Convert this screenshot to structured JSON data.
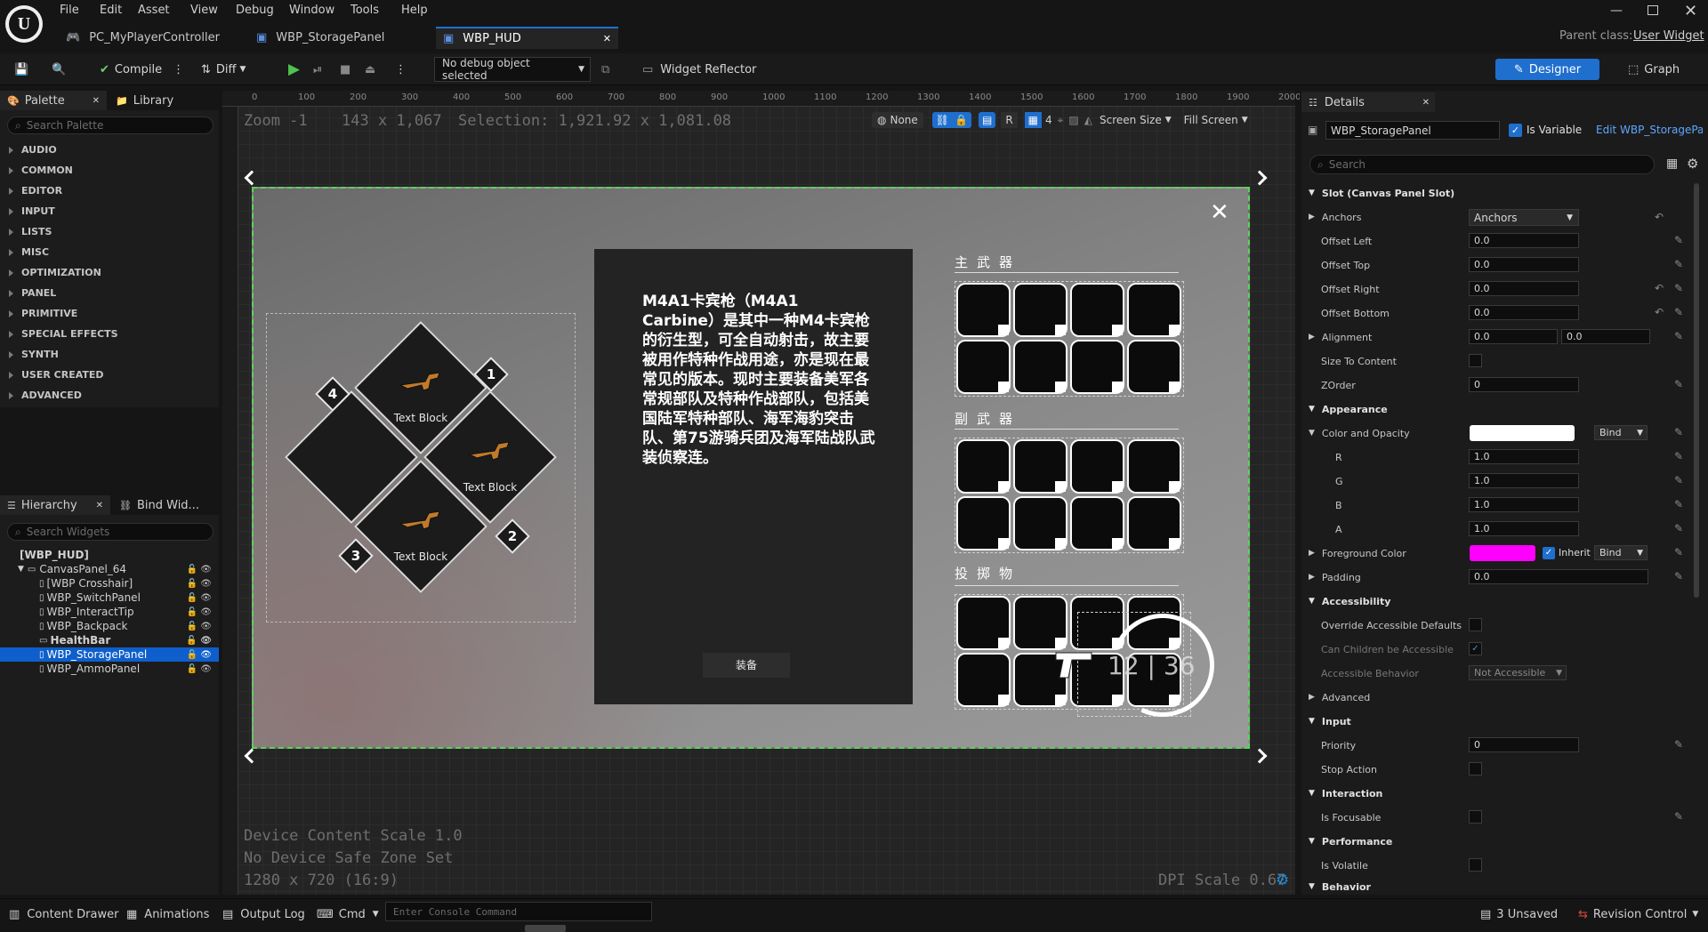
{
  "menu": [
    "File",
    "Edit",
    "Asset",
    "View",
    "Debug",
    "Window",
    "Tools",
    "Help"
  ],
  "tabs": [
    "PC_MyPlayerController",
    "WBP_StoragePanel",
    "WBP_HUD"
  ],
  "parent_class": {
    "label": "Parent class:",
    "value": "User Widget"
  },
  "toolbar": {
    "compile": "Compile",
    "diff": "Diff",
    "debug_select": "No debug object selected",
    "widget_reflector": "Widget Reflector",
    "designer": "Designer",
    "graph": "Graph"
  },
  "palette": {
    "tab": "Palette",
    "library": "Library",
    "search_placeholder": "Search Palette",
    "categories": [
      "AUDIO",
      "COMMON",
      "EDITOR",
      "INPUT",
      "LISTS",
      "MISC",
      "OPTIMIZATION",
      "PANEL",
      "PRIMITIVE",
      "SPECIAL EFFECTS",
      "SYNTH",
      "USER CREATED",
      "ADVANCED"
    ]
  },
  "hierarchy": {
    "tab": "Hierarchy",
    "bind": "Bind Wid...",
    "search_placeholder": "Search Widgets",
    "items": [
      "[WBP_HUD]",
      "CanvasPanel_64",
      "[WBP Crosshair]",
      "WBP_SwitchPanel",
      "WBP_InteractTip",
      "WBP_Backpack",
      "HealthBar",
      "WBP_StoragePanel",
      "WBP_AmmoPanel"
    ]
  },
  "canvas": {
    "zoom": "Zoom -1",
    "size": "143 x 1,067",
    "selection": "Selection: 1,921.92 x 1,081.08",
    "none": "None",
    "r": "R",
    "grid": "4",
    "screen_size": "Screen Size",
    "fill_screen": "Fill Screen",
    "ruler": [
      "0",
      "100",
      "200",
      "300",
      "400",
      "500",
      "600",
      "700",
      "800",
      "900",
      "1000",
      "1100",
      "1200",
      "1300",
      "1400",
      "1500",
      "1600",
      "1700",
      "1800",
      "1900",
      "2000"
    ],
    "device_scale": "Device Content Scale 1.0",
    "safe_zone": "No Device Safe Zone Set",
    "resolution": "1280 x 720 (16:9)",
    "dpi": "DPI Scale 0.67"
  },
  "hud": {
    "wheel_labels": [
      "Text Block",
      "Text Block",
      "Text Block"
    ],
    "wheel_nums": [
      "1",
      "2",
      "3",
      "4"
    ],
    "description_1": "M4A1卡宾枪（M4A1 Carbine）是其中一种M4卡宾枪的衍生型，可全自动射击，故主要被用作特种作战用途，亦是现在最常见的版本。现时主要装备美军各常规部队及特种作战部队，包括美国陆军特种部队、海军海豹突击队、第75游骑兵团及海军陆战队武装侦察连。",
    "equip": "装备",
    "sections": [
      "主武器",
      "副武器",
      "投掷物"
    ],
    "ammo": "12 | 36"
  },
  "details": {
    "tab": "Details",
    "name": "WBP_StoragePanel",
    "is_variable": "Is Variable",
    "edit_link": "Edit WBP_StoragePanel",
    "search_placeholder": "Search",
    "slot_section": "Slot (Canvas Panel Slot)",
    "anchors_label": "Anchors",
    "anchors_value": "Anchors",
    "offset_left": {
      "label": "Offset Left",
      "value": "0.0"
    },
    "offset_top": {
      "label": "Offset Top",
      "value": "0.0"
    },
    "offset_right": {
      "label": "Offset Right",
      "value": "0.0"
    },
    "offset_bottom": {
      "label": "Offset Bottom",
      "value": "0.0"
    },
    "alignment": {
      "label": "Alignment",
      "x": "0.0",
      "y": "0.0"
    },
    "size_to_content": "Size To Content",
    "zorder": {
      "label": "ZOrder",
      "value": "0"
    },
    "appearance": "Appearance",
    "color_opacity": "Color and Opacity",
    "bind": "Bind",
    "rgba": [
      {
        "label": "R",
        "value": "1.0"
      },
      {
        "label": "G",
        "value": "1.0"
      },
      {
        "label": "B",
        "value": "1.0"
      },
      {
        "label": "A",
        "value": "1.0"
      }
    ],
    "foreground": "Foreground Color",
    "inherit": "Inherit",
    "padding": {
      "label": "Padding",
      "value": "0.0"
    },
    "accessibility": "Accessibility",
    "override_acc": "Override Accessible Defaults",
    "can_children": "Can Children be Accessible",
    "acc_behavior": {
      "label": "Accessible Behavior",
      "value": "Not Accessible"
    },
    "advanced": "Advanced",
    "input": "Input",
    "priority": {
      "label": "Priority",
      "value": "0"
    },
    "stop_action": "Stop Action",
    "interaction": "Interaction",
    "is_focusable": "Is Focusable",
    "performance": "Performance",
    "is_volatile": "Is Volatile",
    "behavior": "Behavior",
    "color_white": "#ffffff",
    "color_magenta": "#ff00ff"
  },
  "status": {
    "content_drawer": "Content Drawer",
    "animations": "Animations",
    "output_log": "Output Log",
    "cmd": "Cmd",
    "console_placeholder": "Enter Console Command",
    "unsaved": "3 Unsaved",
    "revision": "Revision Control"
  },
  "colors": {
    "accent": "#1f6fcf",
    "selection": "#0e5fcc",
    "green": "#5fd35f"
  }
}
